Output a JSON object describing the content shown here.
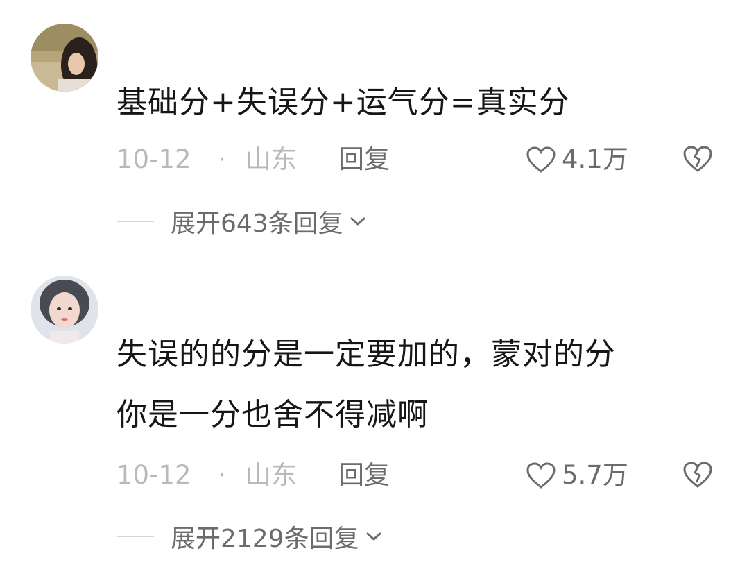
{
  "comments": [
    {
      "username": "",
      "text_lines": [
        "基础分+失误分+运气分=真实分"
      ],
      "date": "10-12",
      "dot": "·",
      "location": "山东",
      "reply_label": "回复",
      "like_count": "4.1万",
      "expand_label": "展开643条回复"
    },
    {
      "username": "",
      "text_lines": [
        "失误的的分是一定要加的，蒙对的分",
        "你是一分也舍不得减啊"
      ],
      "date": "10-12",
      "dot": "·",
      "location": "山东",
      "reply_label": "回复",
      "like_count": "5.7万",
      "expand_label": "展开2129条回复"
    }
  ],
  "icons": {
    "like": "heart-outline-icon",
    "dislike": "broken-heart-icon",
    "expand": "chevron-down-icon"
  },
  "colors": {
    "text_primary": "#161616",
    "text_meta": "#b9b9b9",
    "text_action": "#6b6b6b",
    "divider": "#d6d6d6"
  }
}
